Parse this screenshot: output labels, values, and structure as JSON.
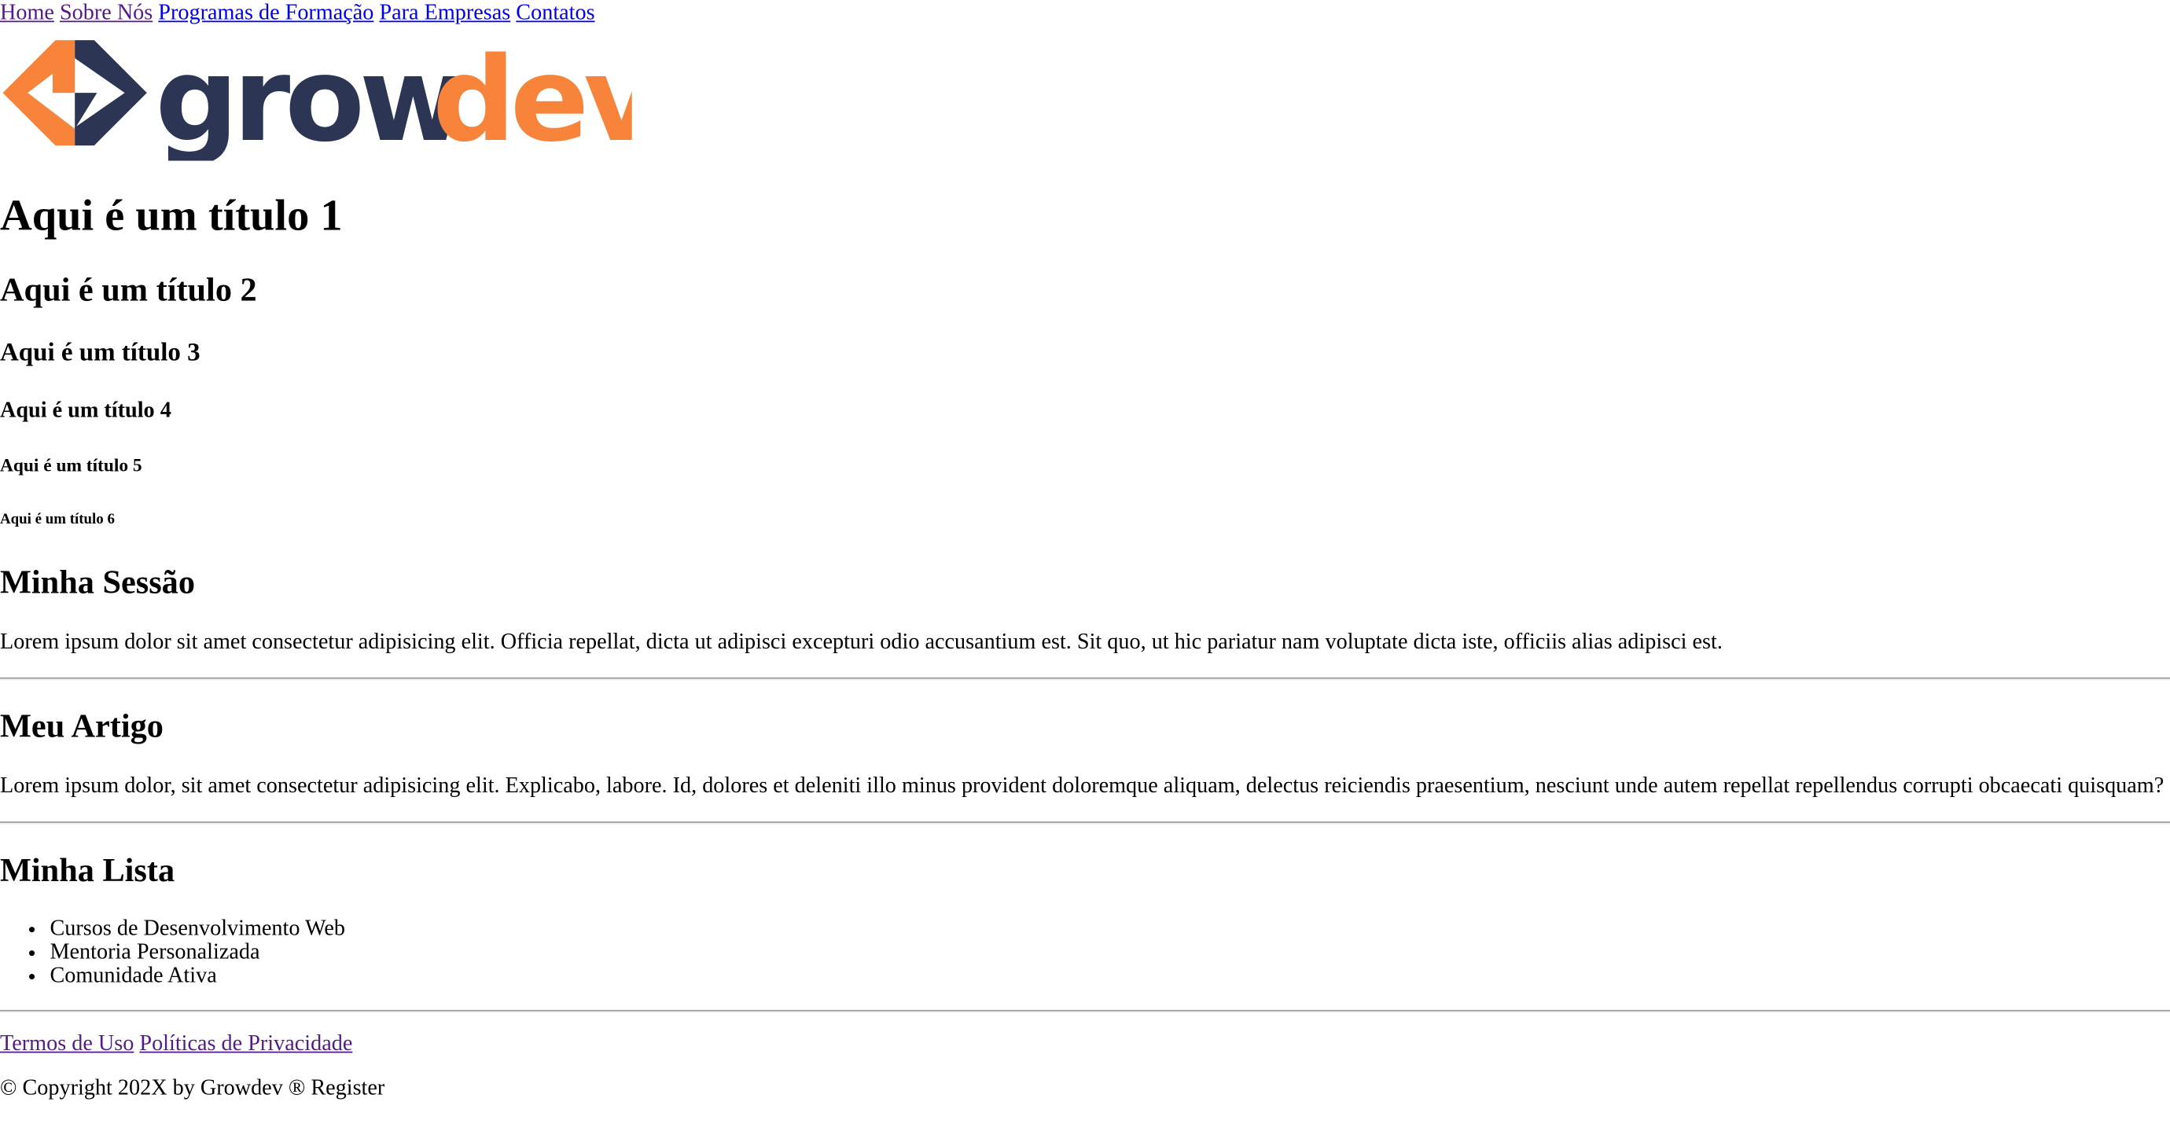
{
  "nav": {
    "items": [
      "Home",
      "Sobre Nós",
      "Programas de Formação",
      "Para Empresas",
      "Contatos"
    ]
  },
  "logo": {
    "text_dark": "grow",
    "text_accent": "dev",
    "colors": {
      "dark": "#2c3654",
      "accent": "#f7843a"
    }
  },
  "headings": {
    "h1": "Aqui é um título 1",
    "h2": "Aqui é um título 2",
    "h3": "Aqui é um título 3",
    "h4": "Aqui é um título 4",
    "h5": "Aqui é um título 5",
    "h6": "Aqui é um título 6"
  },
  "section": {
    "title": "Minha Sessão",
    "text": "Lorem ipsum dolor sit amet consectetur adipisicing elit. Officia repellat, dicta ut adipisci excepturi odio accusantium est. Sit quo, ut hic pariatur nam voluptate dicta iste, officiis alias adipisci est."
  },
  "article": {
    "title": "Meu Artigo",
    "text": "Lorem ipsum dolor, sit amet consectetur adipisicing elit. Explicabo, labore. Id, dolores et deleniti illo minus provident doloremque aliquam, delectus reiciendis praesentium, nesciunt unde autem repellat repellendus corrupti obcaecati quisquam?"
  },
  "list": {
    "title": "Minha Lista",
    "items": [
      "Cursos de Desenvolvimento Web",
      "Mentoria Personalizada",
      "Comunidade Ativa"
    ]
  },
  "footer": {
    "links": [
      "Termos de Uso",
      "Políticas de Privacidade"
    ],
    "copyright": "© Copyright 202X by Growdev ® Register"
  },
  "colors": {
    "link": "#0000ee",
    "visited_link": "#551a8b"
  }
}
